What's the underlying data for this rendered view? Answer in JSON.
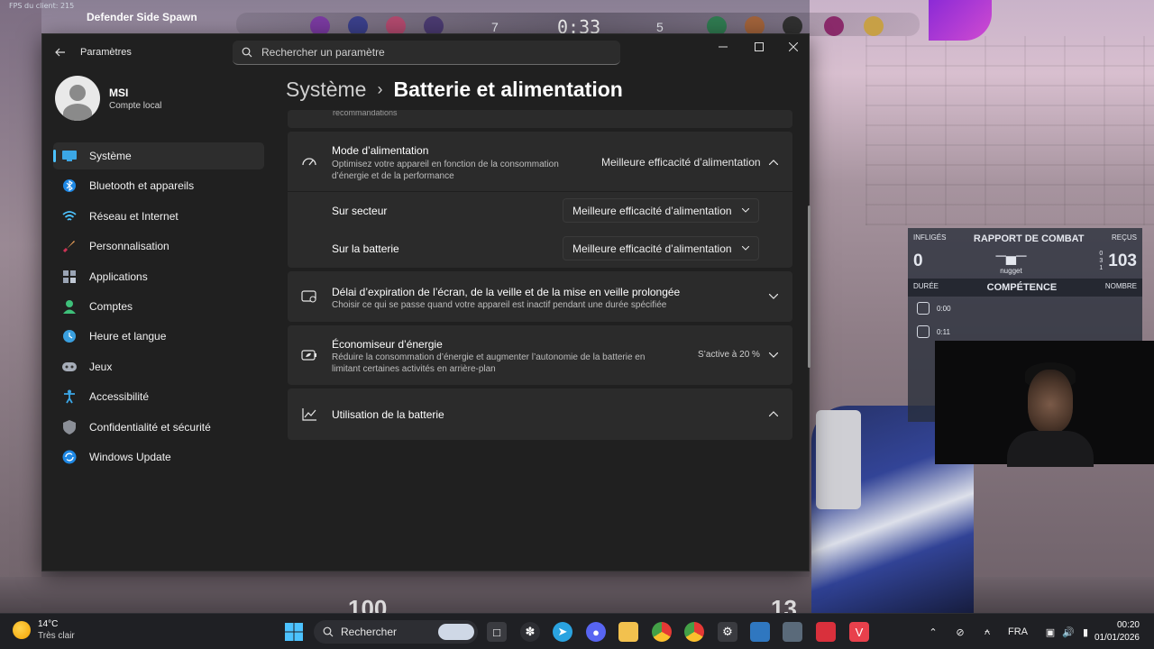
{
  "game": {
    "fps_label": "FPS du client: 215",
    "spawn_label": "Defender Side Spawn",
    "score_left": "7",
    "timer": "0:33",
    "score_right": "5",
    "bottom_left_number": "100",
    "bottom_right_number": "13",
    "combat_report": {
      "inflicted_label": "INFLIGÉS",
      "title": "RAPPORT DE COMBAT",
      "received_label": "REÇUS",
      "inflicted_value": "0",
      "weapon_owner": "nugget",
      "received_value": "103",
      "kills_detail": [
        "0",
        "3",
        "1"
      ],
      "duration_label": "DURÉE",
      "competence_title": "COMPÉTENCE",
      "count_label": "NOMBRE",
      "ability_times": [
        "0:00",
        "0:11"
      ]
    }
  },
  "settings": {
    "app_title": "Paramètres",
    "search_placeholder": "Rechercher un paramètre",
    "profile": {
      "name": "MSI",
      "account_type": "Compte local"
    },
    "nav": [
      {
        "label": "Système",
        "icon": "monitor-icon",
        "active": true
      },
      {
        "label": "Bluetooth et appareils",
        "icon": "bluetooth-icon"
      },
      {
        "label": "Réseau et Internet",
        "icon": "wifi-icon"
      },
      {
        "label": "Personnalisation",
        "icon": "brush-icon"
      },
      {
        "label": "Applications",
        "icon": "apps-icon"
      },
      {
        "label": "Comptes",
        "icon": "person-icon"
      },
      {
        "label": "Heure et langue",
        "icon": "globe-clock-icon"
      },
      {
        "label": "Jeux",
        "icon": "gamepad-icon"
      },
      {
        "label": "Accessibilité",
        "icon": "accessibility-icon"
      },
      {
        "label": "Confidentialité et sécurité",
        "icon": "shield-icon"
      },
      {
        "label": "Windows Update",
        "icon": "update-icon"
      }
    ],
    "breadcrumb": {
      "parent": "Système",
      "current": "Batterie et alimentation"
    },
    "previous_card_tail": "recommandations",
    "power_mode": {
      "title": "Mode d’alimentation",
      "subtitle": "Optimisez votre appareil en fonction de la consommation d’énergie et de la performance",
      "value": "Meilleure efficacité d’alimentation",
      "on_ac_label": "Sur secteur",
      "on_ac_value": "Meilleure efficacité d’alimentation",
      "on_battery_label": "Sur la batterie",
      "on_battery_value": "Meilleure efficacité d’alimentation"
    },
    "screen_timeout": {
      "title": "Délai d’expiration de l’écran, de la veille et de la mise en veille prolongée",
      "subtitle": "Choisir ce qui se passe quand votre appareil est inactif pendant une durée spécifiée"
    },
    "battery_saver": {
      "title": "Économiseur d’énergie",
      "subtitle": "Réduire la consommation d’énergie et augmenter l’autonomie de la batterie en limitant certaines activités en arrière-plan",
      "value": "S’active à 20 %"
    },
    "battery_usage": {
      "title": "Utilisation de la batterie"
    }
  },
  "taskbar": {
    "weather_temp": "14°C",
    "weather_desc": "Très clair",
    "search_label": "Rechercher",
    "language": "FRA",
    "time": "00:20",
    "date": "01/01/2026"
  },
  "colors": {
    "accent": "#4cc2ff",
    "window_bg": "#202020",
    "card_bg": "#2b2b2b",
    "taskbar_bg": "#1f2024"
  }
}
